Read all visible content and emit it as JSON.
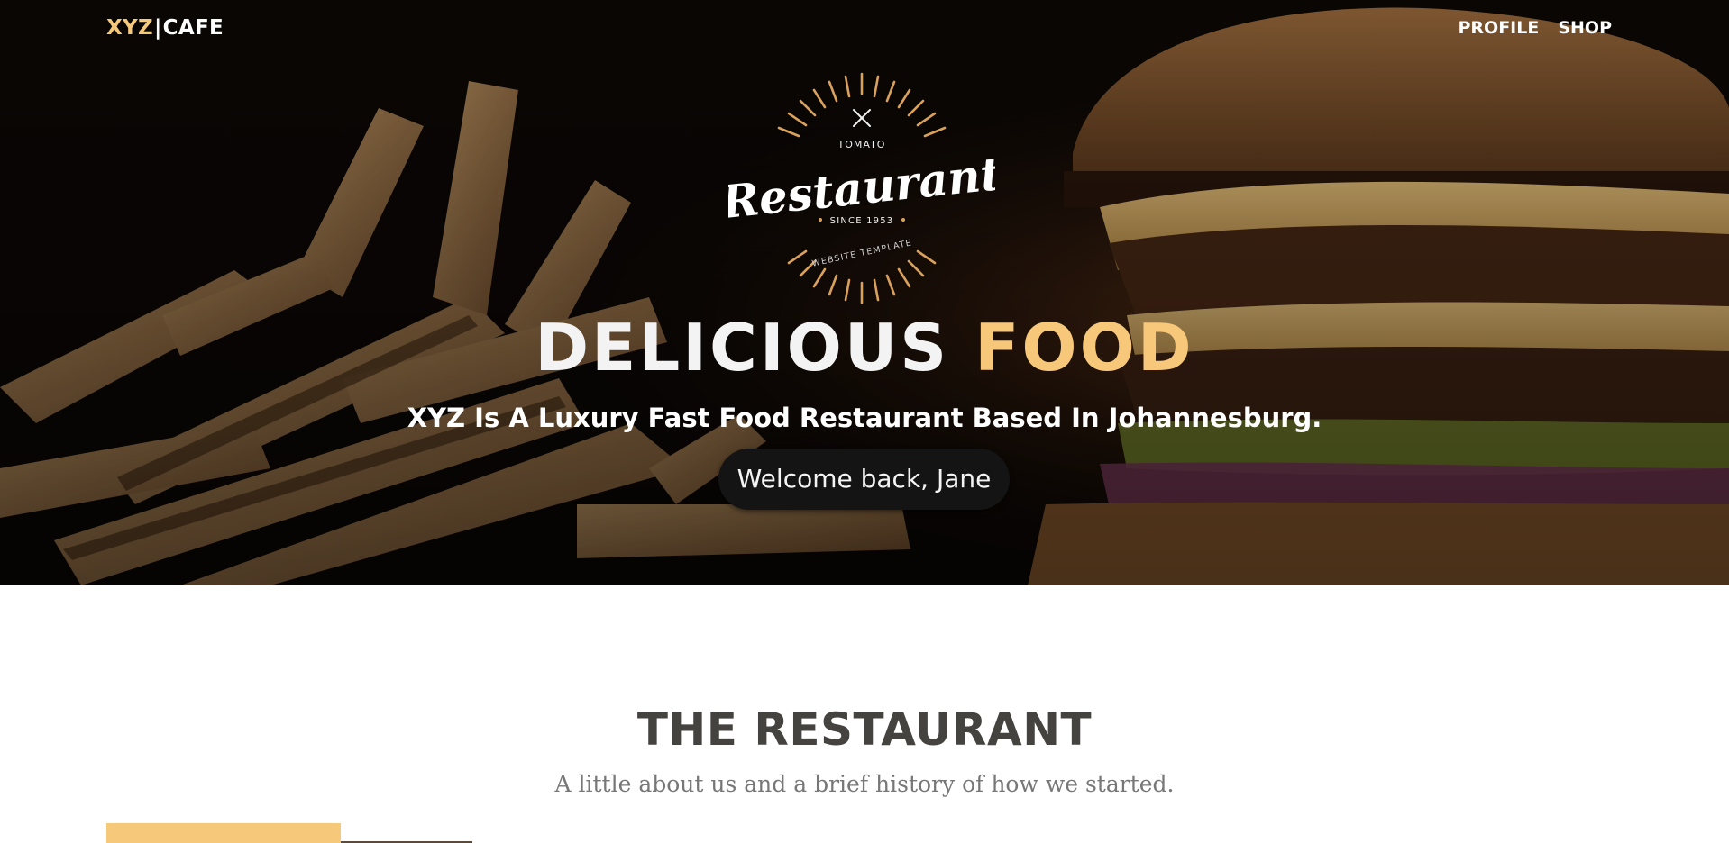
{
  "nav": {
    "brand_part1": "XYZ",
    "brand_sep": "|",
    "brand_part2": "CAFE",
    "links": [
      {
        "label": "PROFILE"
      },
      {
        "label": "SHOP"
      }
    ]
  },
  "hero": {
    "logo": {
      "top_text": "TOMATO",
      "main_text": "Restaurant",
      "since_text": "SINCE 1953",
      "bottom_text": "WEBSITE TEMPLATE"
    },
    "title_part1": "DELICIOUS",
    "title_part2": "FOOD",
    "subtitle": "XYZ Is A Luxury Fast Food Restaurant Based In Johannesburg.",
    "welcome": "Welcome back, Jane"
  },
  "about": {
    "title": "THE RESTAURANT",
    "subtitle": "A little about us and a brief history of how we started."
  },
  "colors": {
    "accent": "#f6c97a",
    "hero_title_accent": "#f7c77a",
    "dark_heading": "#45433f",
    "muted_text": "#777777",
    "welcome_bg": "#141414"
  }
}
